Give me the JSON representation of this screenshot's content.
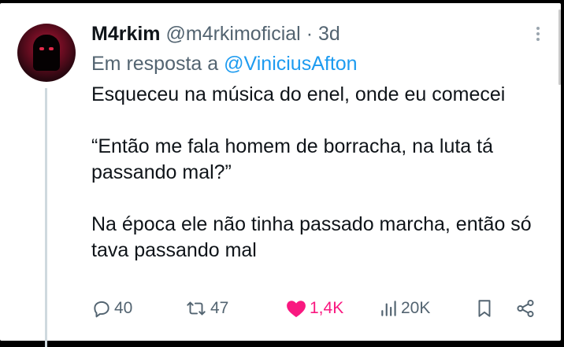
{
  "post": {
    "author_name": "M4rkim",
    "author_handle": "@m4rkimoficial",
    "separator": "·",
    "time": "3d",
    "reply_prefix": "Em resposta a",
    "reply_to": "@ViniciusAfton",
    "text_lines": [
      "Esqueceu na música do enel, onde eu comecei",
      "“Então me fala homem de borracha, na luta tá passando mal?”",
      "Na época ele não tinha passado marcha, então só tava passando mal"
    ]
  },
  "actions": {
    "replies": "40",
    "reposts": "47",
    "likes": "1,4K",
    "views": "20K"
  },
  "colors": {
    "text": "#0f1419",
    "secondary": "#536471",
    "mention": "#1d9bf0",
    "like": "#f91880"
  },
  "icons": [
    "avatar",
    "more-icon",
    "reply-icon",
    "repost-icon",
    "heart-icon",
    "views-icon",
    "bookmark-icon",
    "share-icon"
  ]
}
